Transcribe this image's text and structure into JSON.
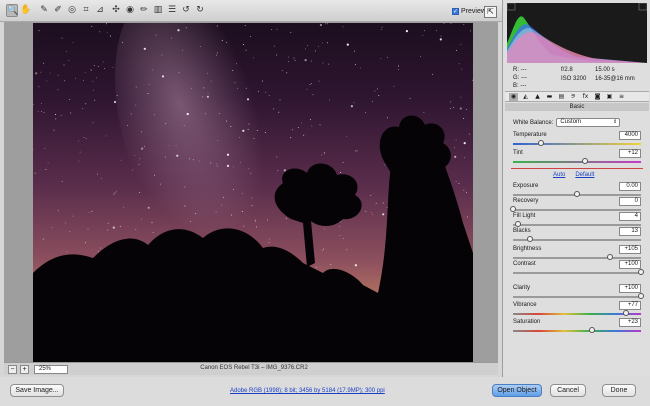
{
  "toolbar": {
    "tools": [
      {
        "name": "zoom-tool-icon",
        "glyph": "🔍"
      },
      {
        "name": "hand-tool-icon",
        "glyph": "✋"
      },
      {
        "name": "white-balance-tool-icon",
        "glyph": "✎"
      },
      {
        "name": "color-sampler-tool-icon",
        "glyph": "✐"
      },
      {
        "name": "targeted-adjustment-tool-icon",
        "glyph": "◎"
      },
      {
        "name": "crop-tool-icon",
        "glyph": "⌗"
      },
      {
        "name": "straighten-tool-icon",
        "glyph": "⊿"
      },
      {
        "name": "spot-removal-tool-icon",
        "glyph": "✣"
      },
      {
        "name": "red-eye-tool-icon",
        "glyph": "◉"
      },
      {
        "name": "adjustment-brush-icon",
        "glyph": "✏"
      },
      {
        "name": "graduated-filter-icon",
        "glyph": "▥"
      },
      {
        "name": "preferences-icon",
        "glyph": "☰"
      },
      {
        "name": "rotate-left-icon",
        "glyph": "↺"
      },
      {
        "name": "rotate-right-icon",
        "glyph": "↻"
      }
    ],
    "preview_label": "Preview",
    "preview_checked": "✓",
    "fullscreen_glyph": "⇱"
  },
  "status": {
    "zoom_out": "−",
    "zoom_in": "+",
    "zoom_value": "25%",
    "filename": "Canon EOS Rebel T3i  –  IMG_9376.CR2"
  },
  "bottom": {
    "save_image": "Save Image...",
    "workflow_info": "Adobe RGB (1998); 8 bit; 3456 by 5184 (17.9MP); 300 ppi",
    "open_object": "Open Object",
    "cancel": "Cancel",
    "done": "Done"
  },
  "info": {
    "r_label": "R:",
    "r_value": "---",
    "g_label": "G:",
    "g_value": "---",
    "b_label": "B:",
    "b_value": "---",
    "aperture": "f/2.8",
    "shutter": "15.00 s",
    "iso": "ISO 3200",
    "lens": "16-35@16 mm"
  },
  "panel": {
    "tab_glyphs": [
      "◉",
      "◭",
      "▲",
      "▬",
      "▤",
      "⚞",
      "fx",
      "◙",
      "▣",
      "≡"
    ],
    "title": "Basic",
    "white_balance_label": "White Balance:",
    "white_balance_value": "Custom",
    "auto_label": "Auto",
    "default_label": "Default",
    "sliders": [
      {
        "key": "temperature",
        "label": "Temperature",
        "value": "4000",
        "level": 0.22,
        "track": "linear-gradient(90deg,#2f62d6,#f0d43a)"
      },
      {
        "key": "tint",
        "label": "Tint",
        "value": "+12",
        "level": 0.56,
        "track": "linear-gradient(90deg,#39b34a,#c63bc4)"
      },
      {
        "key": "exposure",
        "label": "Exposure",
        "value": "0.00",
        "level": 0.5,
        "track": ""
      },
      {
        "key": "recovery",
        "label": "Recovery",
        "value": "0",
        "level": 0.0,
        "track": ""
      },
      {
        "key": "fill-light",
        "label": "Fill Light",
        "value": "4",
        "level": 0.04,
        "track": ""
      },
      {
        "key": "blacks",
        "label": "Blacks",
        "value": "13",
        "level": 0.13,
        "track": ""
      },
      {
        "key": "brightness",
        "label": "Brightness",
        "value": "+105",
        "level": 0.76,
        "track": ""
      },
      {
        "key": "contrast",
        "label": "Contrast",
        "value": "+100",
        "level": 1.0,
        "track": ""
      },
      {
        "key": "clarity",
        "label": "Clarity",
        "value": "+100",
        "level": 1.0,
        "track": ""
      },
      {
        "key": "vibrance",
        "label": "Vibrance",
        "value": "+77",
        "level": 0.88,
        "track": "linear-gradient(90deg,#888,#d8453a,#e0c03a,#3bb04a,#3a7ad8,#b63ac6)"
      },
      {
        "key": "saturation",
        "label": "Saturation",
        "value": "+23",
        "level": 0.62,
        "track": "linear-gradient(90deg,#888,#d8453a,#e0c03a,#3bb04a,#3a7ad8,#b63ac6)"
      }
    ]
  }
}
